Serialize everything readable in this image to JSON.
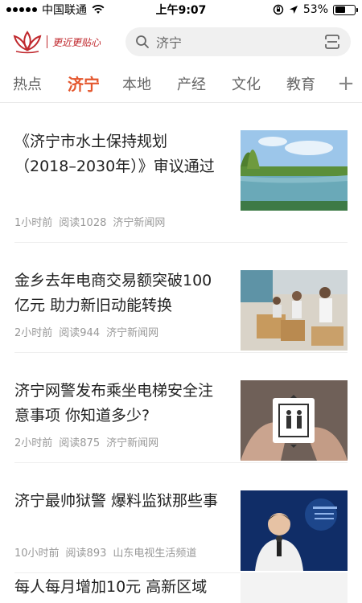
{
  "status_bar": {
    "carrier": "中国联通",
    "time": "上午9:07",
    "battery": "53%",
    "battery_level": 0.53,
    "icons": [
      "signal-icon",
      "wifi-icon",
      "orientation-lock-icon",
      "location-icon",
      "battery-icon"
    ]
  },
  "header": {
    "logo_slogan": "更近更贴心",
    "search_value": "济宁",
    "icons": [
      "lotus-logo-icon",
      "search-icon",
      "scan-icon"
    ]
  },
  "tabs": {
    "items": [
      "热点",
      "济宁",
      "本地",
      "产经",
      "文化",
      "教育"
    ],
    "active": "济宁",
    "add_label": "+"
  },
  "news": [
    {
      "title": "《济宁市水土保持规划（2018–2030年）》审议通过",
      "time": "1小时前",
      "reads": "阅读1028",
      "source": "济宁新闻网",
      "thumb": "lake-landscape"
    },
    {
      "title": "金乡去年电商交易额突破100亿元 助力新旧动能转换",
      "time": "2小时前",
      "reads": "阅读944",
      "source": "济宁新闻网",
      "thumb": "warehouse-workers"
    },
    {
      "title": "济宁网警发布乘坐电梯安全注意事项 你知道多少?",
      "time": "2小时前",
      "reads": "阅读875",
      "source": "济宁新闻网",
      "thumb": "elevator-hands"
    },
    {
      "title": "济宁最帅狱警 爆料监狱那些事",
      "time": "10小时前",
      "reads": "阅读893",
      "source": "山东电视生活频道",
      "thumb": "tv-show-speaker"
    }
  ],
  "partial_item": {
    "title": "每人每月增加10元 高新区域"
  },
  "colors": {
    "accent": "#e4572e",
    "logo_red": "#c0282d",
    "meta_gray": "#999999"
  }
}
